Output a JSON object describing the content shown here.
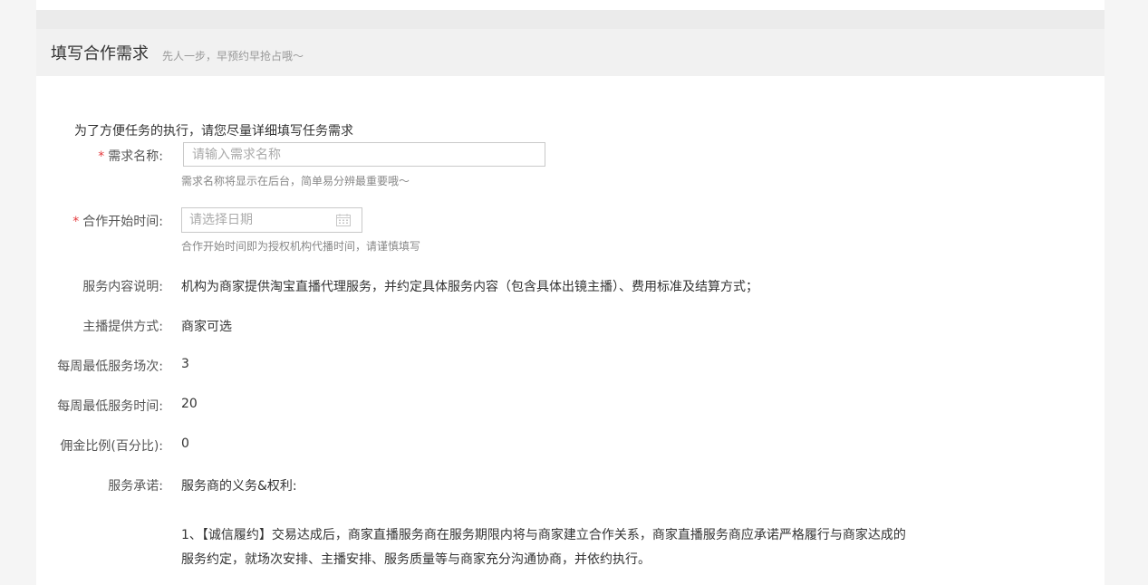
{
  "header": {
    "title": "填写合作需求",
    "subtitle": "先人一步，早预约早抢占哦～"
  },
  "form": {
    "intro": "为了方便任务的执行，请您尽量详细填写任务需求",
    "required_mark": "*",
    "name_field": {
      "label": "需求名称:",
      "placeholder": "请输入需求名称",
      "value": "",
      "hint": "需求名称将显示在后台，简单易分辨最重要哦～"
    },
    "start_time_field": {
      "label": "合作开始时间:",
      "placeholder": "请选择日期",
      "value": "",
      "hint": "合作开始时间即为授权机构代播时间，请谨慎填写",
      "icon": "calendar-icon"
    },
    "service_desc": {
      "label": "服务内容说明:",
      "value": "机构为商家提供淘宝直播代理服务，并约定具体服务内容（包含具体出镜主播）、费用标准及结算方式；"
    },
    "anchor_provision": {
      "label": "主播提供方式:",
      "value": "商家可选"
    },
    "min_weekly_sessions": {
      "label": "每周最低服务场次:",
      "value": "3"
    },
    "min_weekly_hours": {
      "label": "每周最低服务时间:",
      "value": "20"
    },
    "commission": {
      "label": "佣金比例(百分比):",
      "value": "0"
    },
    "commitment": {
      "label": "服务承诺:",
      "heading": "服务商的义务&权利:",
      "paragraph_1": "1、【诚信履约】交易达成后，商家直播服务商在服务期限内将与商家建立合作关系，商家直播服务商应承诺严格履行与商家达成的服务约定，就场次安排、主播安排、服务质量等与商家充分沟通协商，并依约执行。"
    }
  }
}
